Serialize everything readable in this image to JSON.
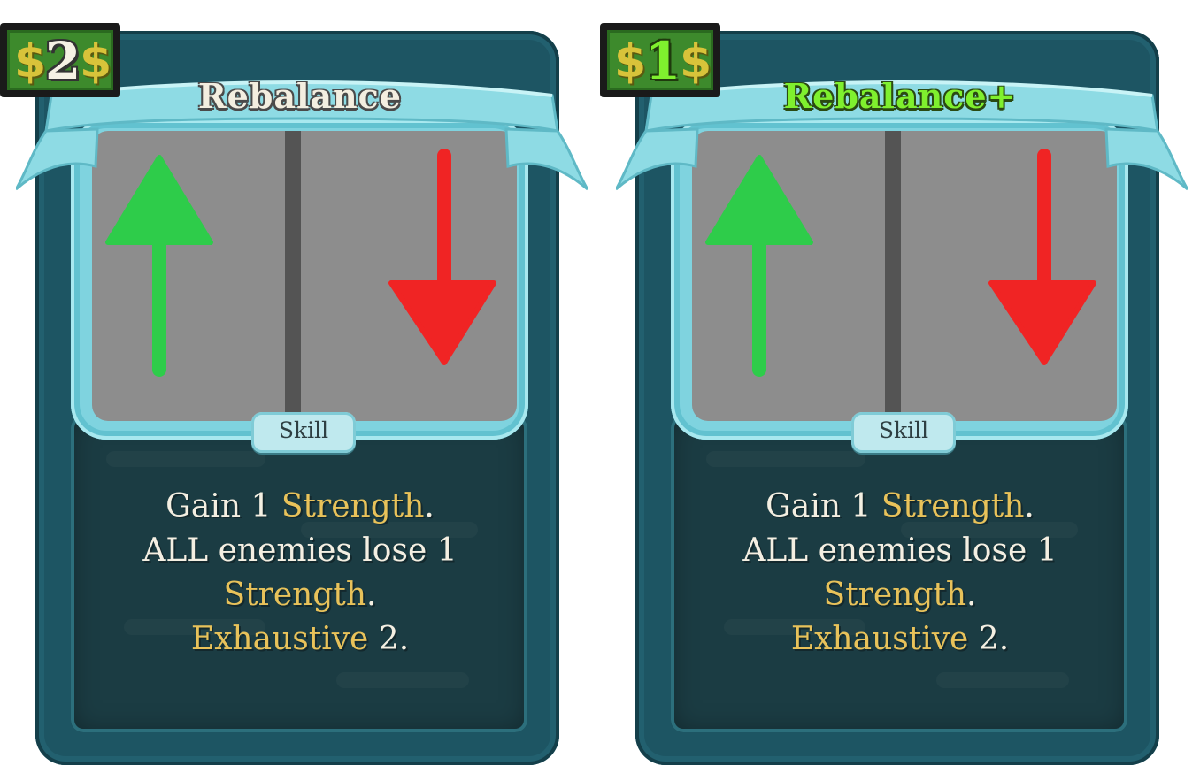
{
  "cards": [
    {
      "cost": "2",
      "cost_symbol": "$",
      "title": "Rebalance",
      "upgraded": false,
      "type": "Skill",
      "description": {
        "line1_a": "Gain 1 ",
        "line1_kw": "Strength",
        "line1_b": ".",
        "line2": "ALL enemies lose 1",
        "line3_kw": "Strength",
        "line3_b": ".",
        "line4_kw": "Exhaustive",
        "line4_b": " 2."
      },
      "art": {
        "left_arrow": "up-arrow-icon",
        "right_arrow": "down-arrow-icon"
      }
    },
    {
      "cost": "1",
      "cost_symbol": "$",
      "title": "Rebalance+",
      "upgraded": true,
      "type": "Skill",
      "description": {
        "line1_a": "Gain 1 ",
        "line1_kw": "Strength",
        "line1_b": ".",
        "line2": "ALL enemies lose 1",
        "line3_kw": "Strength",
        "line3_b": ".",
        "line4_kw": "Exhaustive",
        "line4_b": " 2."
      },
      "art": {
        "left_arrow": "up-arrow-icon",
        "right_arrow": "down-arrow-icon"
      }
    }
  ],
  "colors": {
    "up_arrow": "#2ecc4a",
    "down_arrow": "#f02424",
    "keyword": "#e8c25a",
    "upgraded_text": "#7ff02e",
    "frame": "#1d5563",
    "banner": "#8edbe4"
  }
}
